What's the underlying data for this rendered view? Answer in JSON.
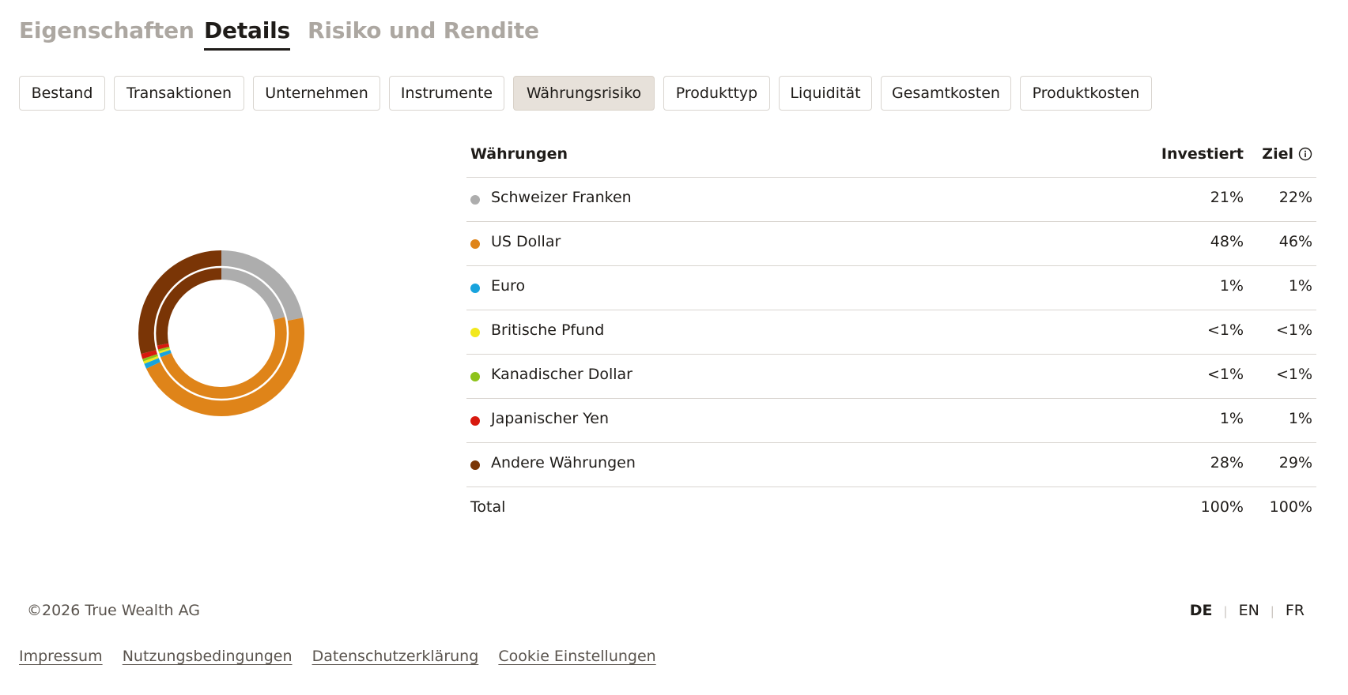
{
  "main_tabs": [
    {
      "label": "Eigenschaften",
      "active": false
    },
    {
      "label": "Details",
      "active": true
    },
    {
      "label": "Risiko und Rendite",
      "active": false
    }
  ],
  "sub_tabs": [
    {
      "label": "Bestand",
      "active": false
    },
    {
      "label": "Transaktionen",
      "active": false
    },
    {
      "label": "Unternehmen",
      "active": false
    },
    {
      "label": "Instrumente",
      "active": false
    },
    {
      "label": "Währungsrisiko",
      "active": true
    },
    {
      "label": "Produkttyp",
      "active": false
    },
    {
      "label": "Liquidität",
      "active": false
    },
    {
      "label": "Gesamtkosten",
      "active": false
    },
    {
      "label": "Produktkosten",
      "active": false
    }
  ],
  "table": {
    "headers": {
      "currency": "Währungen",
      "invested": "Investiert",
      "target": "Ziel"
    },
    "info_icon": "info-icon",
    "rows": [
      {
        "name": "Schweizer Franken",
        "color": "#adadad",
        "invested": "21%",
        "target": "22%"
      },
      {
        "name": "US Dollar",
        "color": "#df8419",
        "invested": "48%",
        "target": "46%"
      },
      {
        "name": "Euro",
        "color": "#18a3dd",
        "invested": "1%",
        "target": "1%"
      },
      {
        "name": "Britische Pfund",
        "color": "#f2e81c",
        "invested": "<1%",
        "target": "<1%"
      },
      {
        "name": "Kanadischer Dollar",
        "color": "#8ec31b",
        "invested": "<1%",
        "target": "<1%"
      },
      {
        "name": "Japanischer Yen",
        "color": "#d8190f",
        "invested": "1%",
        "target": "1%"
      },
      {
        "name": "Andere Währungen",
        "color": "#7a3506",
        "invested": "28%",
        "target": "29%"
      }
    ],
    "total": {
      "label": "Total",
      "invested": "100%",
      "target": "100%"
    }
  },
  "chart_data": {
    "type": "pie",
    "variant": "double-donut",
    "categories": [
      "Schweizer Franken",
      "US Dollar",
      "Euro",
      "Britische Pfund",
      "Kanadischer Dollar",
      "Japanischer Yen",
      "Andere Währungen"
    ],
    "colors": [
      "#adadad",
      "#df8419",
      "#18a3dd",
      "#f2e81c",
      "#8ec31b",
      "#d8190f",
      "#7a3506"
    ],
    "series": [
      {
        "name": "Ziel",
        "ring": "outer",
        "values": [
          22,
          46,
          1,
          0.5,
          0.5,
          1,
          29
        ]
      },
      {
        "name": "Investiert",
        "ring": "inner",
        "values": [
          21,
          48,
          1,
          0.5,
          0.5,
          1,
          28
        ]
      }
    ]
  },
  "footer": {
    "copyright": "©2026 True Wealth AG",
    "languages": [
      {
        "label": "DE",
        "active": true
      },
      {
        "label": "EN",
        "active": false
      },
      {
        "label": "FR",
        "active": false
      }
    ],
    "links": [
      "Impressum",
      "Nutzungsbedingungen",
      "Datenschutzerklärung",
      "Cookie Einstellungen"
    ]
  }
}
